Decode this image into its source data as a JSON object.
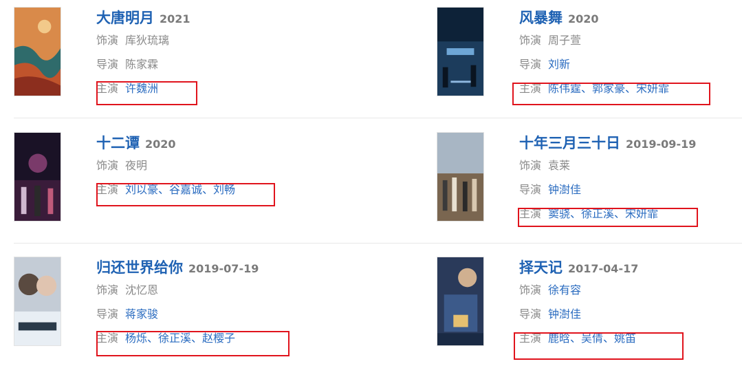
{
  "labels": {
    "cast": "饰演",
    "director": "导演",
    "starring": "主演"
  },
  "movies": [
    {
      "title": "大唐明月",
      "year": "2021",
      "cast": "库狄琉璃",
      "director": "陈家霖",
      "starring": "许魏洲"
    },
    {
      "title": "风暴舞",
      "year": "2020",
      "cast": "周子萱",
      "director": "刘新",
      "starring": "陈伟霆、郭家豪、宋妍霏"
    },
    {
      "title": "十二谭",
      "year": "2020",
      "cast": "夜明",
      "starring": "刘以豪、谷嘉诚、刘畅"
    },
    {
      "title": "十年三月三十日",
      "year": "2019-09-19",
      "cast": "袁莱",
      "director": "钟澍佳",
      "starring": "窦骁、徐正溪、宋妍霏"
    },
    {
      "title": "归还世界给你",
      "year": "2019-07-19",
      "cast": "沈忆恩",
      "director": "蒋家骏",
      "starring": "杨烁、徐正溪、赵樱子"
    },
    {
      "title": "择天记",
      "year": "2017-04-17",
      "cast": "徐有容",
      "director": "钟澍佳",
      "starring": "鹿晗、吴倩、姚笛"
    }
  ],
  "colors": {
    "title": "#1f62b3",
    "link": "#2b6cc0",
    "highlight": "#e0131c",
    "muted": "#8a8a8a"
  }
}
